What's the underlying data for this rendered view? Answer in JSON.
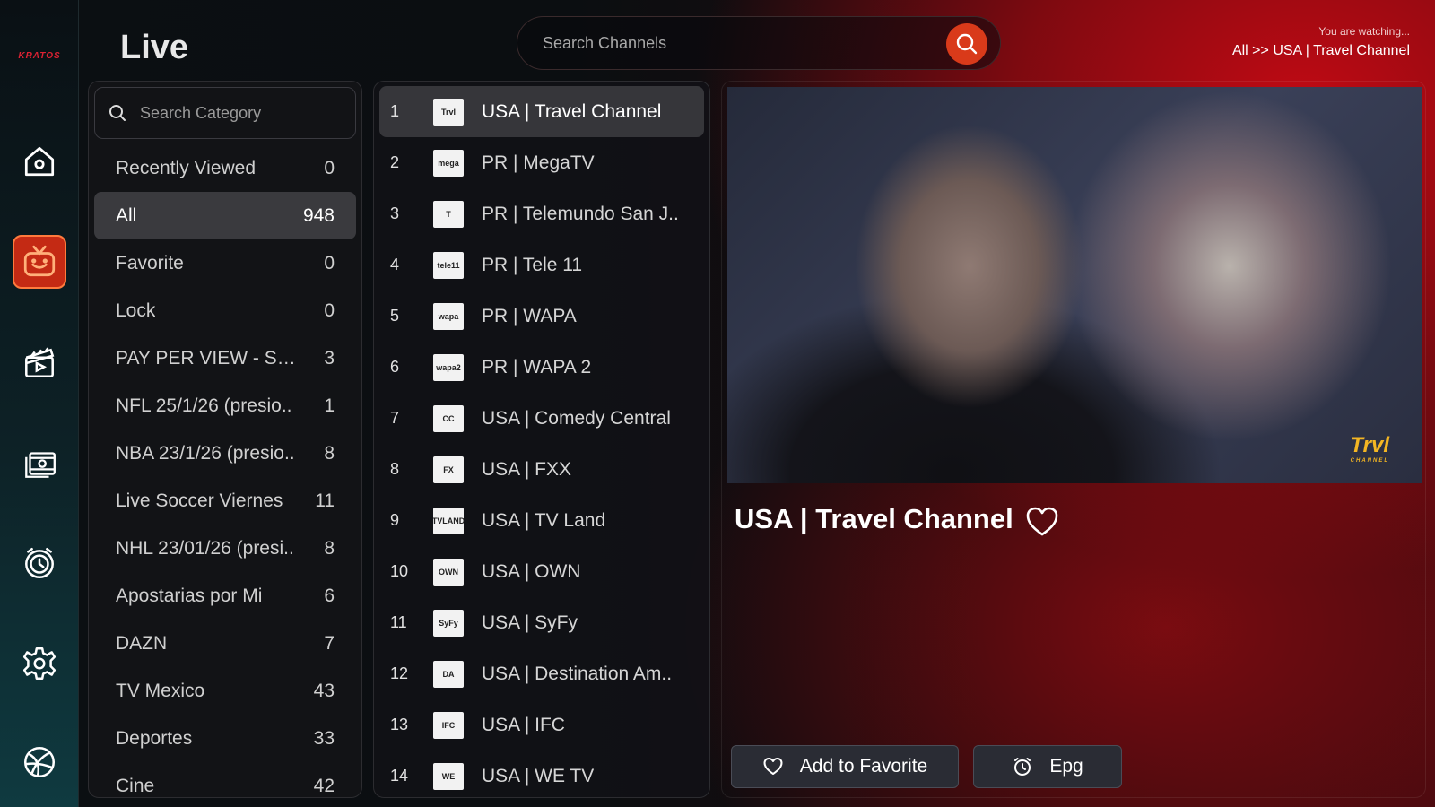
{
  "app": {
    "logo_text": "KRATOS",
    "page_title": "Live"
  },
  "rail": {
    "items": [
      {
        "name": "home",
        "icon": "home-icon"
      },
      {
        "name": "live-tv",
        "icon": "tv-icon",
        "active": true
      },
      {
        "name": "movies",
        "icon": "clapperboard-icon"
      },
      {
        "name": "series",
        "icon": "film-stack-icon"
      },
      {
        "name": "catch-up",
        "icon": "timer-icon"
      },
      {
        "name": "settings",
        "icon": "gear-icon"
      },
      {
        "name": "sports",
        "icon": "sports-ball-icon"
      }
    ],
    "accent_color": "#c42a14"
  },
  "search": {
    "placeholder": "Search Channels"
  },
  "watching": {
    "caption": "You are watching...",
    "path": "All >> USA | Travel Channel"
  },
  "categories": {
    "search_placeholder": "Search Category",
    "items": [
      {
        "label": "Recently Viewed",
        "count": "0"
      },
      {
        "label": "All",
        "count": "948",
        "active": true
      },
      {
        "label": "Favorite",
        "count": "0"
      },
      {
        "label": "Lock",
        "count": "0"
      },
      {
        "label": "PAY PER VIEW - SUN..",
        "count": "3"
      },
      {
        "label": "NFL 25/1/26 (presio..",
        "count": "1"
      },
      {
        "label": "NBA 23/1/26 (presio..",
        "count": "8"
      },
      {
        "label": "Live Soccer Viernes",
        "count": "11"
      },
      {
        "label": "NHL 23/01/26 (presi..",
        "count": "8"
      },
      {
        "label": "Apostarias por Mi",
        "count": "6"
      },
      {
        "label": "DAZN",
        "count": "7"
      },
      {
        "label": "TV Mexico",
        "count": "43"
      },
      {
        "label": "Deportes",
        "count": "33"
      },
      {
        "label": "Cine",
        "count": "42"
      }
    ]
  },
  "channels": [
    {
      "num": "1",
      "name": "USA | Travel Channel",
      "logo": "Trvl",
      "active": true
    },
    {
      "num": "2",
      "name": "PR | MegaTV",
      "logo": "mega"
    },
    {
      "num": "3",
      "name": "PR | Telemundo San J..",
      "logo": "T"
    },
    {
      "num": "4",
      "name": "PR | Tele 11",
      "logo": "tele11"
    },
    {
      "num": "5",
      "name": "PR | WAPA",
      "logo": "wapa"
    },
    {
      "num": "6",
      "name": "PR | WAPA 2",
      "logo": "wapa2"
    },
    {
      "num": "7",
      "name": "USA | Comedy Central",
      "logo": "CC"
    },
    {
      "num": "8",
      "name": "USA | FXX",
      "logo": "FX"
    },
    {
      "num": "9",
      "name": "USA | TV Land",
      "logo": "TVLAND"
    },
    {
      "num": "10",
      "name": "USA | OWN",
      "logo": "OWN"
    },
    {
      "num": "11",
      "name": "USA | SyFy",
      "logo": "SyFy"
    },
    {
      "num": "12",
      "name": "USA | Destination Am..",
      "logo": "DA"
    },
    {
      "num": "13",
      "name": "USA | IFC",
      "logo": "IFC"
    },
    {
      "num": "14",
      "name": "USA | WE TV",
      "logo": "WE"
    }
  ],
  "player": {
    "now_title": "USA | Travel Channel",
    "watermark": "Trvl",
    "watermark_sub": "CHANNEL",
    "add_favorite_label": "Add to Favorite",
    "epg_label": "Epg"
  }
}
